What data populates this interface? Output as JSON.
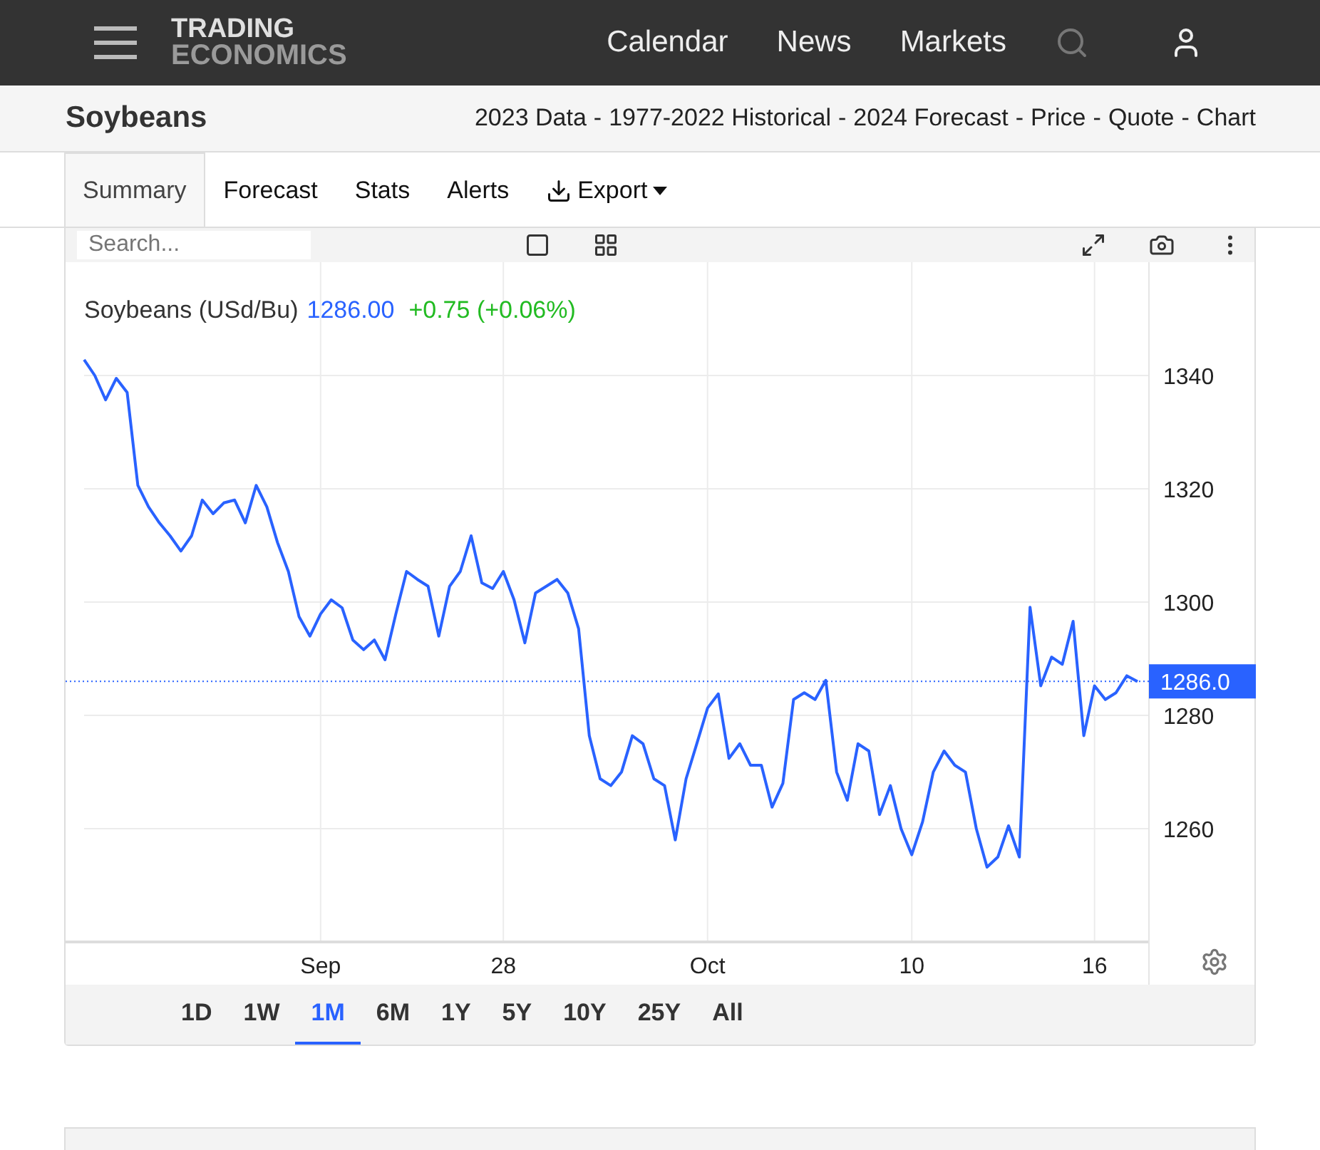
{
  "header": {
    "logo_top": "TRADING",
    "logo_bottom": "ECONOMICS",
    "nav": [
      "Calendar",
      "News",
      "Markets"
    ]
  },
  "subheader": {
    "title": "Soybeans",
    "separator": "-",
    "links": [
      "2023 Data",
      "1977-2022 Historical",
      "2024 Forecast",
      "Price",
      "Quote",
      "Chart"
    ]
  },
  "tabs": [
    {
      "label": "Summary",
      "selected": true,
      "kind": "tab"
    },
    {
      "label": "Forecast",
      "selected": false,
      "kind": "tab"
    },
    {
      "label": "Stats",
      "selected": false,
      "kind": "tab"
    },
    {
      "label": "Alerts",
      "selected": false,
      "kind": "tab"
    },
    {
      "label": "Export",
      "selected": false,
      "kind": "dropdown"
    }
  ],
  "toolbar": {
    "search": {
      "placeholder": "Search..."
    }
  },
  "legend": {
    "price": "1286.00",
    "change": "+0.75 (+0.06%)"
  },
  "last_price_label": "1286.0",
  "chart_data": {
    "type": "line",
    "grid": true,
    "ref_lines": [
      {
        "axis": "y",
        "value": 1286
      }
    ],
    "ylim": [
      1240,
      1360
    ],
    "yticks": [
      1260,
      1280,
      1300,
      1320,
      1340
    ],
    "categories": [
      null,
      null,
      null,
      null,
      null,
      null,
      null,
      null,
      null,
      null,
      null,
      null,
      null,
      null,
      null,
      null,
      null,
      null,
      null,
      null,
      null,
      null,
      "Sep",
      null,
      null,
      null,
      null,
      null,
      null,
      null,
      null,
      null,
      null,
      null,
      null,
      null,
      null,
      null,
      null,
      "28",
      null,
      null,
      null,
      null,
      null,
      null,
      null,
      null,
      null,
      null,
      null,
      null,
      null,
      null,
      null,
      null,
      null,
      null,
      "Oct",
      null,
      null,
      null,
      null,
      null,
      null,
      null,
      null,
      null,
      null,
      null,
      null,
      null,
      null,
      null,
      null,
      null,
      null,
      "10",
      null,
      null,
      null,
      null,
      null,
      null,
      null,
      null,
      null,
      null,
      null,
      null,
      null,
      null,
      null,
      null,
      "16",
      null,
      null,
      null,
      null
    ],
    "series": [
      {
        "name": "Soybeans (USd/Bu)",
        "color": "#2962ff",
        "values": [
          1342.8,
          1340,
          1335.7,
          1339.5,
          1337,
          1320.6,
          1316.8,
          1314,
          1311.7,
          1309,
          1311.7,
          1318,
          1315.6,
          1317.5,
          1318,
          1314,
          1320.6,
          1316.8,
          1310.5,
          1305.4,
          1297.4,
          1294,
          1297.9,
          1300.4,
          1299,
          1293.3,
          1291.6,
          1293.3,
          1289.8,
          1297.9,
          1305.4,
          1304,
          1302.8,
          1294,
          1302.8,
          1305.4,
          1311.7,
          1303.4,
          1302.4,
          1305.4,
          1300.4,
          1292.8,
          1301.6,
          1302.8,
          1304,
          1301.6,
          1295.3,
          1276.4,
          1268.8,
          1267.6,
          1270,
          1276.4,
          1275,
          1268.8,
          1267.6,
          1258,
          1268.8,
          1275,
          1281.3,
          1283.8,
          1272.4,
          1275,
          1271.2,
          1271.2,
          1263.8,
          1268,
          1282.8,
          1284,
          1282.8,
          1286.2,
          1270,
          1265,
          1275,
          1273.7,
          1262.5,
          1267.6,
          1260,
          1255.4,
          1261.2,
          1270,
          1273.7,
          1271.2,
          1270,
          1260,
          1253.2,
          1255,
          1260.5,
          1255,
          1299.1,
          1285.2,
          1290.3,
          1289,
          1296.6,
          1276.4,
          1285.2,
          1282.8,
          1284,
          1287,
          1286
        ]
      }
    ]
  },
  "ranges": [
    {
      "label": "1D",
      "selected": false
    },
    {
      "label": "1W",
      "selected": false
    },
    {
      "label": "1M",
      "selected": true
    },
    {
      "label": "6M",
      "selected": false
    },
    {
      "label": "1Y",
      "selected": false
    },
    {
      "label": "5Y",
      "selected": false
    },
    {
      "label": "10Y",
      "selected": false
    },
    {
      "label": "25Y",
      "selected": false
    },
    {
      "label": "All",
      "selected": false
    }
  ]
}
